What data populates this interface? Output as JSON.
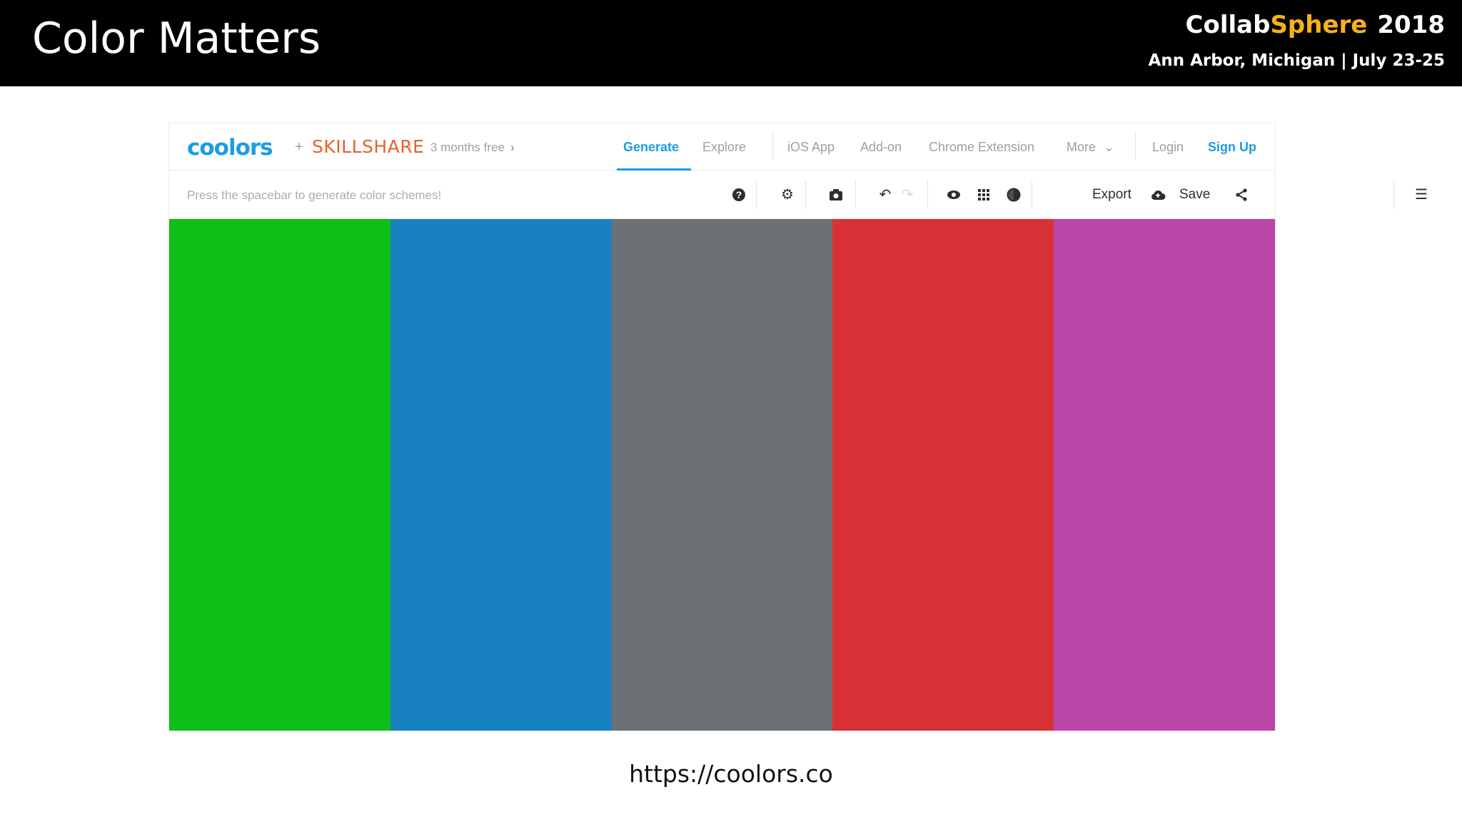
{
  "slide": {
    "title": "Color Matters",
    "brand_part1": "Collab",
    "brand_part2": "Sphere",
    "brand_year": "2018",
    "event_line": "Ann Arbor, Michigan | July 23-25",
    "url": "https://coolors.co"
  },
  "app": {
    "logo": "coolors",
    "plus": "+",
    "partner": "SKILLSHARE",
    "promo": "3 months free",
    "promo_chevron": "›",
    "nav": {
      "generate": "Generate",
      "explore": "Explore",
      "ios_app": "iOS App",
      "addon": "Add-on",
      "chrome_extension": "Chrome Extension",
      "more": "More",
      "more_chevron": "⌄",
      "login": "Login",
      "signup": "Sign Up"
    },
    "toolbar": {
      "hint": "Press the spacebar to generate color schemes!",
      "help_icon": "?",
      "settings_icon": "⚙",
      "camera_icon": "◙",
      "undo_icon": "↶",
      "redo_icon": "↷",
      "eye_icon": "◉",
      "grid_icon": "⠿",
      "contrast_icon": "◐",
      "share_icon": "⋖",
      "export_label": "Export",
      "cloud_icon": "☁",
      "save_label": "Save",
      "menu_icon": "☰"
    },
    "palette": [
      "#0fbe16",
      "#1781c2",
      "#6b7174",
      "#d93236",
      "#bc46a7"
    ]
  }
}
